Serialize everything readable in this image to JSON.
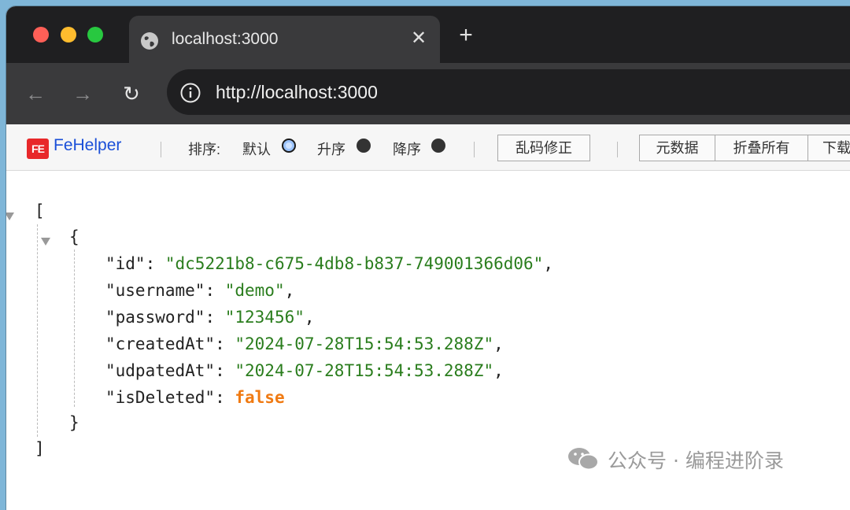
{
  "browser": {
    "tab_title": "localhost:3000",
    "tab_close_glyph": "✕",
    "new_tab_glyph": "+",
    "url": "http://localhost:3000",
    "nav": {
      "back": "←",
      "forward": "→",
      "reload": "↻"
    }
  },
  "fehelper": {
    "logo_text": "FE",
    "name": "FeHelper",
    "sort_label": "排序:",
    "sort_default": "默认",
    "sort_asc": "升序",
    "sort_desc": "降序",
    "fix_encoding": "乱码修正",
    "metadata": "元数据",
    "collapse_all": "折叠所有",
    "download": "下载"
  },
  "json": {
    "open_bracket": "[",
    "open_brace": "{",
    "entries": [
      {
        "key": "\"id\"",
        "value": "\"dc5221b8-c675-4db8-b837-749001366d06\"",
        "type": "string",
        "comma": ","
      },
      {
        "key": "\"username\"",
        "value": "\"demo\"",
        "type": "string",
        "comma": ","
      },
      {
        "key": "\"password\"",
        "value": "\"123456\"",
        "type": "string",
        "comma": ","
      },
      {
        "key": "\"createdAt\"",
        "value": "\"2024-07-28T15:54:53.288Z\"",
        "type": "string",
        "comma": ","
      },
      {
        "key": "\"udpatedAt\"",
        "value": "\"2024-07-28T15:54:53.288Z\"",
        "type": "string",
        "comma": ","
      },
      {
        "key": "\"isDeleted\"",
        "value": "false",
        "type": "boolean",
        "comma": ""
      }
    ],
    "close_brace": "}",
    "close_bracket": "]"
  },
  "watermark": {
    "text": "公众号 · 编程进阶录"
  },
  "icons": [
    "globe-icon",
    "close-icon",
    "plus-icon",
    "back-arrow-icon",
    "forward-arrow-icon",
    "reload-icon",
    "info-icon",
    "fehelper-logo-icon",
    "collapse-triangle-icon",
    "wechat-icon"
  ]
}
